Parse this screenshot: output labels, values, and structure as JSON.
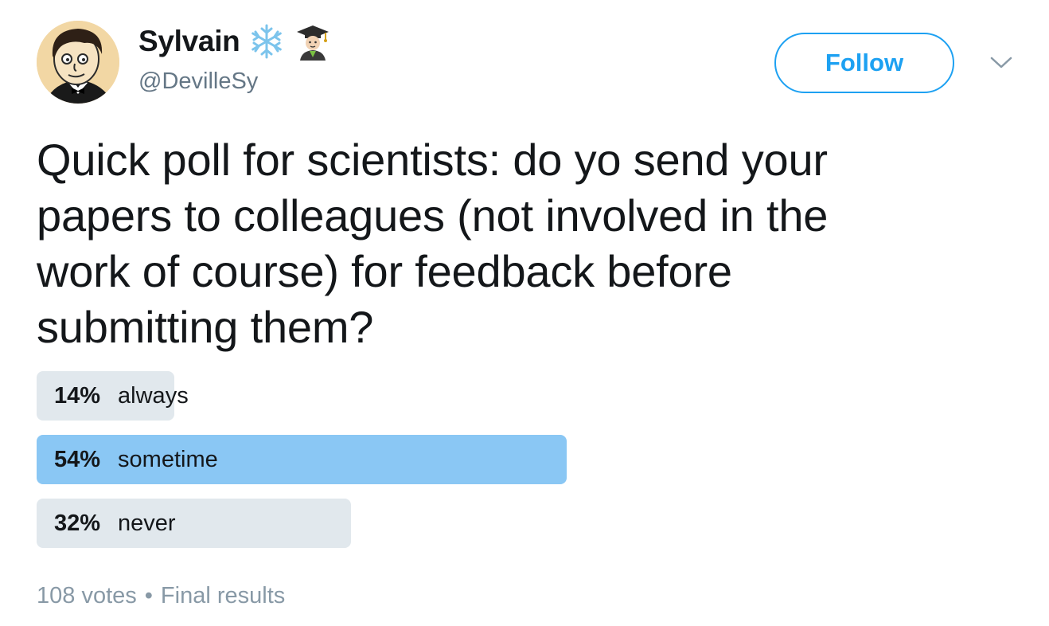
{
  "user": {
    "display_name": "Sylvain",
    "handle": "@DevilleSy",
    "name_emojis": [
      "snowflake-emoji",
      "student-emoji"
    ]
  },
  "actions": {
    "follow_label": "Follow",
    "menu_icon": "chevron-down-icon"
  },
  "tweet": {
    "text_lines": [
      "Quick poll for scientists: do yo send your",
      "papers to colleagues (not involved in the",
      "work of course) for feedback before",
      "submitting them?"
    ]
  },
  "poll": {
    "options": [
      {
        "percent_label": "14%",
        "label": "always",
        "percent": 14,
        "winner": false
      },
      {
        "percent_label": "54%",
        "label": "sometime",
        "percent": 54,
        "winner": true
      },
      {
        "percent_label": "32%",
        "label": "never",
        "percent": 32,
        "winner": false
      }
    ],
    "votes": "108 votes",
    "separator": "•",
    "status": "Final results"
  },
  "colors": {
    "accent": "#1da1f2",
    "winner_bar": "#8ac7f4",
    "bar": "#e1e8ed",
    "muted_text": "#657786"
  }
}
